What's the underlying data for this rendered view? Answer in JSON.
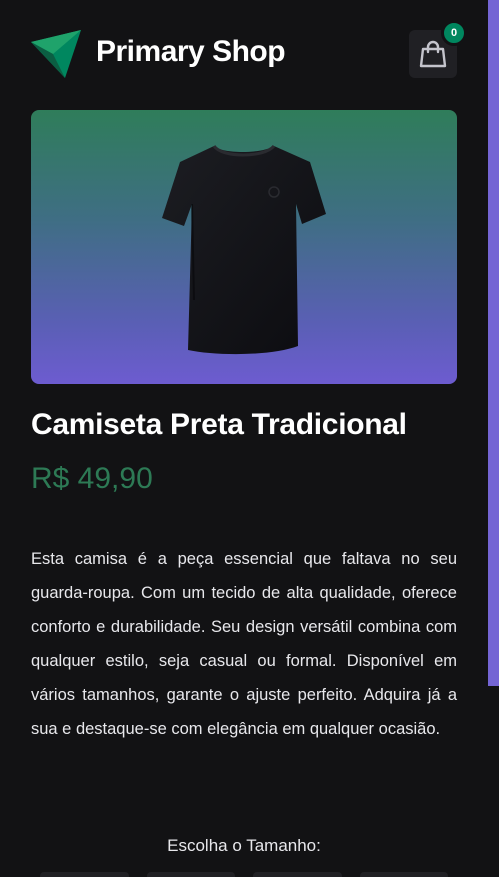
{
  "header": {
    "logo_icon": "triangle-logo-icon",
    "brand": "Primary Shop",
    "cart": {
      "icon": "shopping-bag-icon",
      "count": "0"
    }
  },
  "product": {
    "image_icon": "black-tshirt-image",
    "name": "Camiseta Preta Tradicional",
    "price": "R$ 49,90",
    "description": "Esta camisa é a peça essencial que faltava no seu guarda-roupa. Com um tecido de alta qualidade, oferece conforto e durabilidade. Seu design versátil combina com qualquer estilo, seja casual ou formal. Disponível em vários tamanhos, garante o ajuste perfeito. Adquira já a sua e destaque-se com elegância em qualquer ocasião.",
    "size_label": "Escolha o Tamanho:"
  },
  "colors": {
    "accent": "#00875f",
    "price": "#2d7a55",
    "secondary": "#7465d4",
    "background": "#121214"
  }
}
